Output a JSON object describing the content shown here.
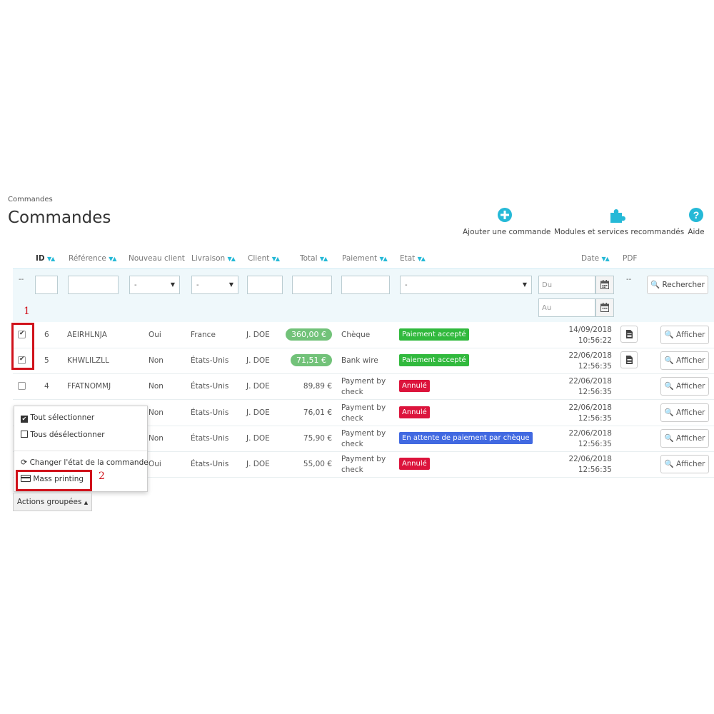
{
  "breadcrumb": "Commandes",
  "page_title": "Commandes",
  "toolbar": {
    "add_order": "Ajouter une commande",
    "modules": "Modules et services recommandés",
    "help": "Aide"
  },
  "columns": {
    "id": "ID",
    "reference": "Référence",
    "new_client": "Nouveau client",
    "delivery": "Livraison",
    "client": "Client",
    "total": "Total",
    "payment": "Paiement",
    "state": "Etat",
    "date": "Date",
    "pdf": "PDF"
  },
  "filters": {
    "left_dash": "--",
    "select_dash": "-",
    "date_from_placeholder": "Du",
    "date_to_placeholder": "Au",
    "pdf_dash": "--",
    "search_label": "Rechercher"
  },
  "rows": [
    {
      "id": "6",
      "ref": "AEIRHLNJA",
      "new": "Oui",
      "delivery": "France",
      "client": "J. DOE",
      "total": "360,00 €",
      "total_pill": true,
      "payment": "Chèque",
      "state": "Paiement accepté",
      "state_color": "#31b93d",
      "date": "14/09/2018",
      "time": "10:56:22",
      "checked": true,
      "pdf": true,
      "view": "Afficher"
    },
    {
      "id": "5",
      "ref": "KHWLILZLL",
      "new": "Non",
      "delivery": "États-Unis",
      "client": "J. DOE",
      "total": "71,51 €",
      "total_pill": true,
      "payment": "Bank wire",
      "state": "Paiement accepté",
      "state_color": "#31b93d",
      "date": "22/06/2018",
      "time": "12:56:35",
      "checked": true,
      "pdf": true,
      "view": "Afficher"
    },
    {
      "id": "4",
      "ref": "FFATNOMMJ",
      "new": "Non",
      "delivery": "États-Unis",
      "client": "J. DOE",
      "total": "89,89 €",
      "total_pill": false,
      "payment": "Payment by check",
      "state": "Annulé",
      "state_color": "#dc143c",
      "date": "22/06/2018",
      "time": "12:56:35",
      "checked": false,
      "pdf": false,
      "view": "Afficher"
    },
    {
      "id": "",
      "ref": "",
      "new": "Non",
      "delivery": "États-Unis",
      "client": "J. DOE",
      "total": "76,01 €",
      "total_pill": false,
      "payment": "Payment by check",
      "state": "Annulé",
      "state_color": "#dc143c",
      "date": "22/06/2018",
      "time": "12:56:35",
      "checked": false,
      "pdf": false,
      "view": "Afficher"
    },
    {
      "id": "",
      "ref": "",
      "new": "Non",
      "delivery": "États-Unis",
      "client": "J. DOE",
      "total": "75,90 €",
      "total_pill": false,
      "payment": "Payment by check",
      "state": "En attente de paiement par chèque",
      "state_color": "#4169e1",
      "date": "22/06/2018",
      "time": "12:56:35",
      "checked": false,
      "pdf": false,
      "view": "Afficher"
    },
    {
      "id": "",
      "ref": "",
      "new": "Oui",
      "delivery": "États-Unis",
      "client": "J. DOE",
      "total": "55,00 €",
      "total_pill": false,
      "payment": "Payment by check",
      "state": "Annulé",
      "state_color": "#dc143c",
      "date": "22/06/2018",
      "time": "12:56:35",
      "checked": false,
      "pdf": false,
      "view": "Afficher"
    }
  ],
  "bulk_menu": {
    "select_all": "Tout sélectionner",
    "deselect_all": "Tous désélectionner",
    "change_state": "Changer l'état de la commande",
    "mass_printing": "Mass printing",
    "button": "Actions groupées"
  },
  "annotations": {
    "step1": "1",
    "step2": "2"
  },
  "colors": {
    "accent": "#25b9d7",
    "pill_green": "#72c279",
    "annotation_red": "#d0121b"
  }
}
